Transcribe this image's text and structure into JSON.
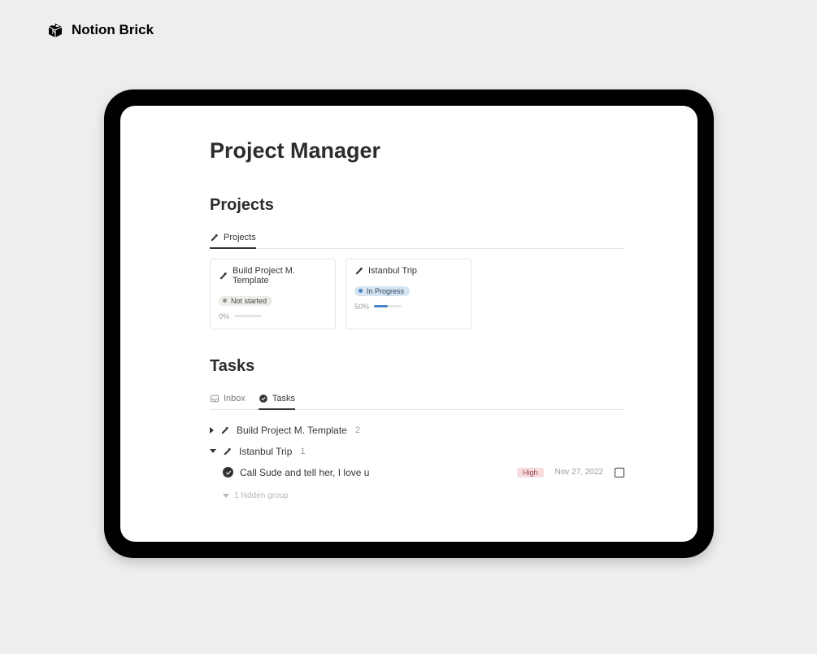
{
  "brand": {
    "name": "Notion Brick"
  },
  "page": {
    "title": "Project Manager"
  },
  "projects": {
    "heading": "Projects",
    "active_tab": "Projects",
    "cards": [
      {
        "title": "Build Project M. Template",
        "status_label": "Not started",
        "status_kind": "gray",
        "progress_label": "0%",
        "progress_value": 0
      },
      {
        "title": "Istanbul Trip",
        "status_label": "In Progress",
        "status_kind": "blue",
        "progress_label": "50%",
        "progress_value": 50
      }
    ]
  },
  "tasks": {
    "heading": "Tasks",
    "tabs": [
      {
        "label": "Inbox",
        "active": false,
        "icon": "inbox-icon"
      },
      {
        "label": "Tasks",
        "active": true,
        "icon": "check-icon"
      }
    ],
    "groups": [
      {
        "title": "Build Project M. Template",
        "count": "2",
        "expanded": false
      },
      {
        "title": "Istanbul Trip",
        "count": "1",
        "expanded": true,
        "items": [
          {
            "title": "Call Sude and tell her, I love u",
            "priority": "High",
            "date": "Nov 27, 2022",
            "done": false
          }
        ]
      }
    ],
    "hidden_group_label": "1 hidden group"
  }
}
